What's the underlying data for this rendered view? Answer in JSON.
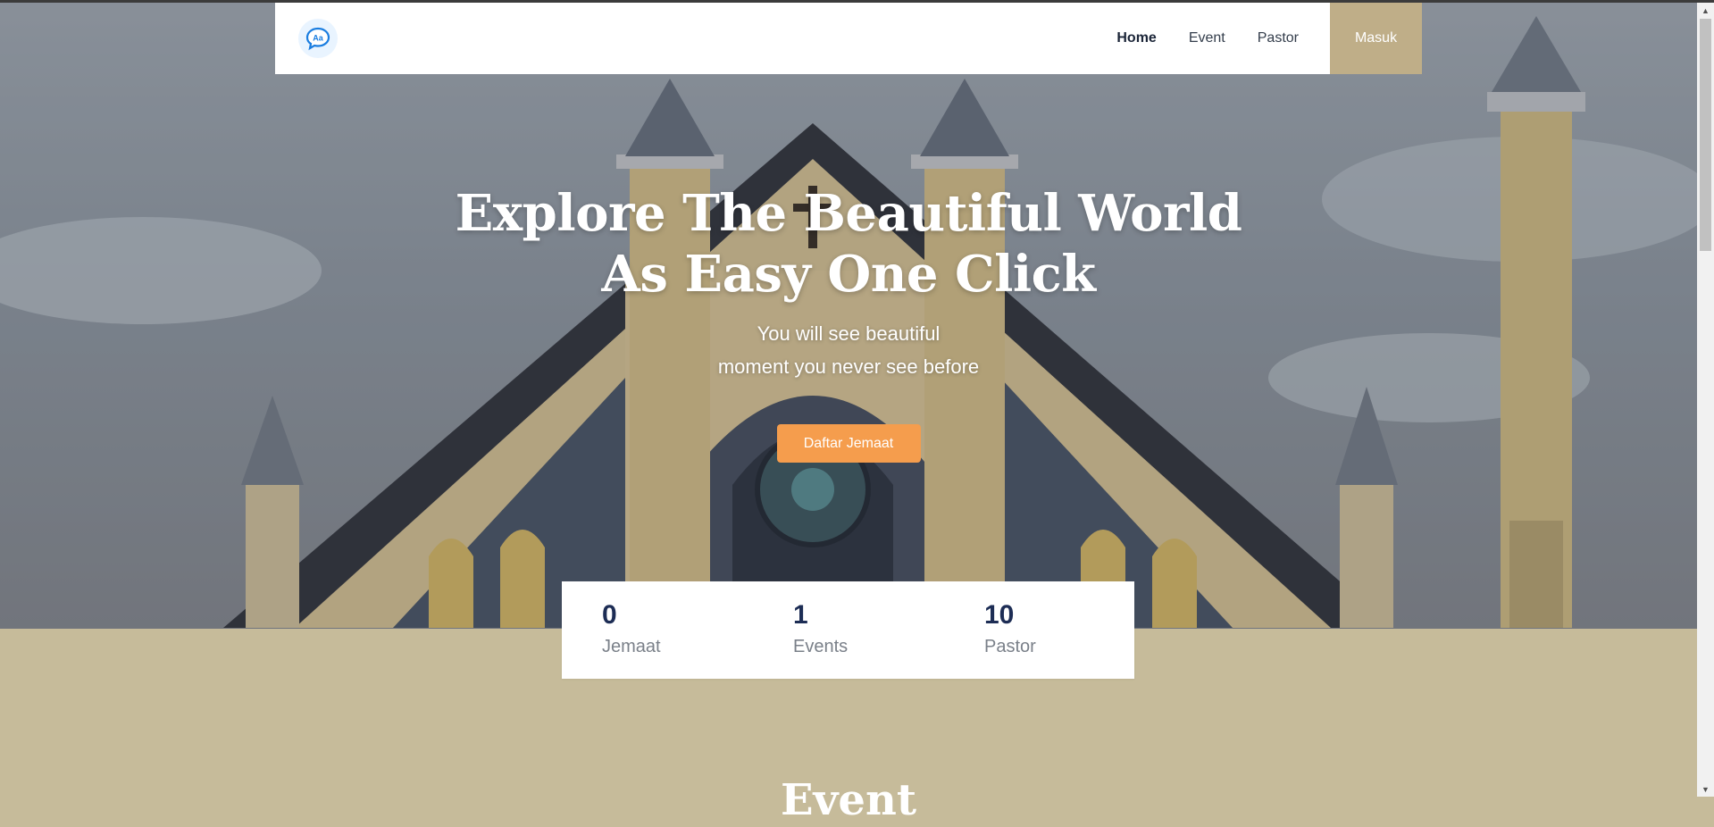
{
  "navbar": {
    "logo_icon": "chat-bubble-logo-icon",
    "logo_text": "Aa",
    "links": [
      {
        "label": "Home",
        "active": true
      },
      {
        "label": "Event",
        "active": false
      },
      {
        "label": "Pastor",
        "active": false
      }
    ],
    "login_label": "Masuk"
  },
  "hero": {
    "title_line1": "Explore The Beautiful World",
    "title_line2": "As Easy One Click",
    "subtitle_line1": "You will see beautiful",
    "subtitle_line2": "moment you never see before",
    "cta_label": "Daftar Jemaat"
  },
  "stats": [
    {
      "value": "0",
      "label": "Jemaat"
    },
    {
      "value": "1",
      "label": "Events"
    },
    {
      "value": "10",
      "label": "Pastor"
    }
  ],
  "section": {
    "heading": "Event"
  },
  "colors": {
    "accent_tan": "#bfae88",
    "cta_orange": "#f59d4d",
    "stat_blue": "#1d2d55",
    "page_bg": "#c6bb9a"
  }
}
